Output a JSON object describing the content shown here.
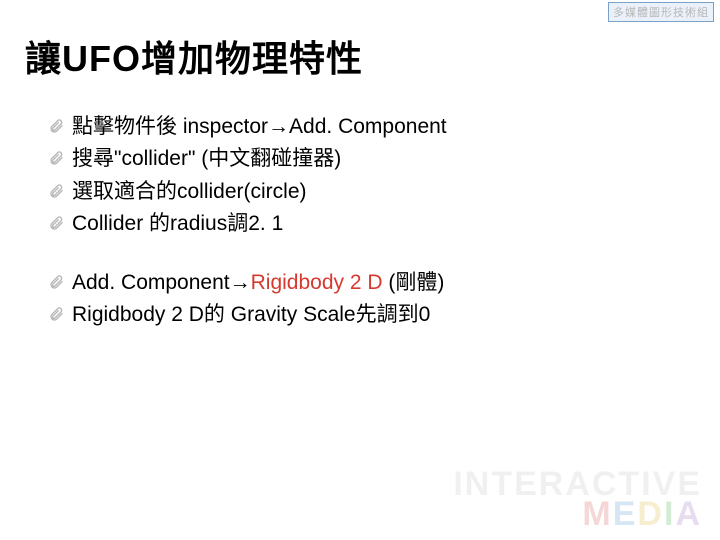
{
  "header_tag": "多媒體圖形技術組",
  "title": "讓UFO增加物理特性",
  "bullet_icon": "paperclip-icon",
  "block1": [
    "點擊物件後 inspector→Add. Component",
    "搜尋\"collider\" (中文翻碰撞器)",
    "選取適合的collider(circle)",
    "Collider 的radius調2. 1"
  ],
  "block2_line1_pre": "Add. Component→",
  "block2_line1_red": "Rigidbody 2 D",
  "block2_line1_post": " (剛體)",
  "block2_line2": "Rigidbody 2 D的 Gravity Scale先調到0",
  "watermark": {
    "line1": "INTERACTIVE",
    "line2": "MEDIA"
  }
}
